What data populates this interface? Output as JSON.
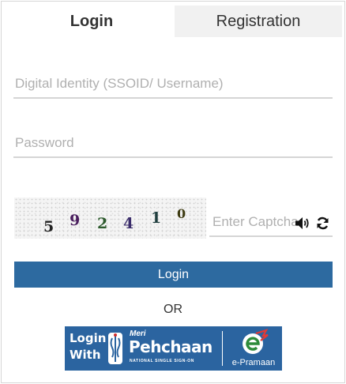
{
  "tabs": {
    "login": "Login",
    "registration": "Registration"
  },
  "form": {
    "ssoid_placeholder": "Digital Identity (SSOID/ Username)",
    "ssoid_value": "",
    "password_placeholder": "Password",
    "password_value": "",
    "captcha_placeholder": "Enter Captcha",
    "captcha_value": "",
    "login_button": "Login"
  },
  "captcha": {
    "digits": [
      {
        "char": "5",
        "color": "#222222"
      },
      {
        "char": "9",
        "color": "#4a1e5e"
      },
      {
        "char": "2",
        "color": "#2e5b2e"
      },
      {
        "char": "4",
        "color": "#3b2d6b"
      },
      {
        "char": "1",
        "color": "#1f3e3e"
      },
      {
        "char": "0",
        "color": "#3e3b12"
      }
    ]
  },
  "icons": {
    "audio": "speaker-icon",
    "refresh": "refresh-icon"
  },
  "divider_text": "OR",
  "meri_pehchaan": {
    "login_with": [
      "Login",
      "With"
    ],
    "meri": "Meri",
    "pehchaan": "Pehchaan",
    "tagline": "NATIONAL SINGLE SIGN-ON",
    "epramaan": "e-Pramaan"
  },
  "colors": {
    "primary": "#2d6aa0",
    "banner": "#2b64a0",
    "tab_inactive": "#f1f1f1",
    "underline": "#d5d5d5",
    "placeholder": "#b0b0b0"
  }
}
